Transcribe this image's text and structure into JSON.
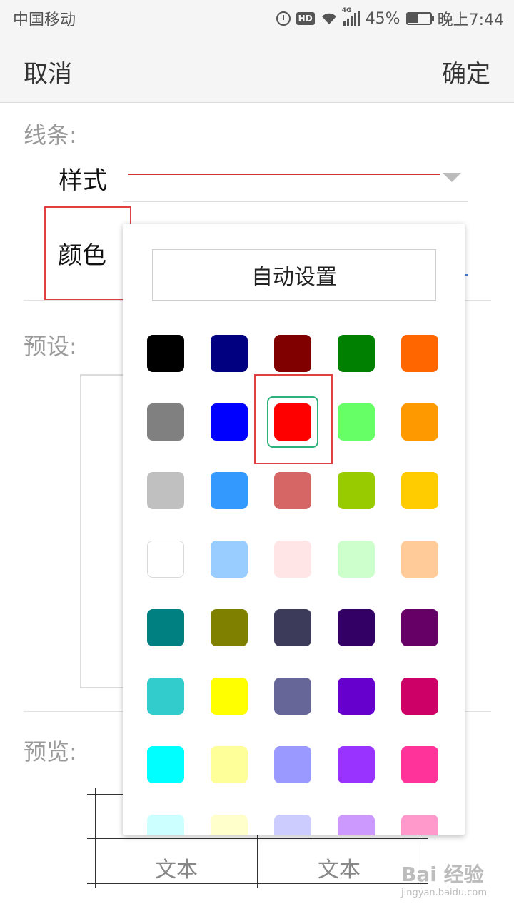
{
  "status_bar": {
    "carrier": "中国移动",
    "network": "4G",
    "battery": "45%",
    "time": "晚上7:44"
  },
  "title_bar": {
    "cancel": "取消",
    "confirm": "确定"
  },
  "line_section": {
    "title": "线条:",
    "style_label": "样式",
    "color_label": "颜色",
    "style_color": "#d33333"
  },
  "preset_section": {
    "title": "预设:"
  },
  "preview_section": {
    "title": "预览:",
    "cells": [
      "文本",
      "文本"
    ]
  },
  "color_picker": {
    "auto_label": "自动设置",
    "selected": "#ff0000",
    "swatches": [
      [
        "#000000",
        "#000080",
        "#800000",
        "#008000",
        "#ff6600"
      ],
      [
        "#808080",
        "#0000ff",
        "#ff0000",
        "#66ff66",
        "#ff9900"
      ],
      [
        "#c0c0c0",
        "#3399ff",
        "#d66666",
        "#99cc00",
        "#ffcc00"
      ],
      [
        "#ffffff",
        "#99ccff",
        "#ffe5e5",
        "#ccffcc",
        "#ffcc99"
      ],
      [
        "#008080",
        "#808000",
        "#3c3c5a",
        "#330066",
        "#660066"
      ],
      [
        "#33cccc",
        "#ffff00",
        "#666699",
        "#6600cc",
        "#cc0066"
      ],
      [
        "#00ffff",
        "#ffff99",
        "#9999ff",
        "#9933ff",
        "#ff3399"
      ],
      [
        "#ccffff",
        "#ffffcc",
        "#ccccff",
        "#cc99ff",
        "#ff99cc"
      ]
    ]
  },
  "watermark": {
    "brand": "Bai 经验",
    "url": "jingyan.baidu.com"
  }
}
